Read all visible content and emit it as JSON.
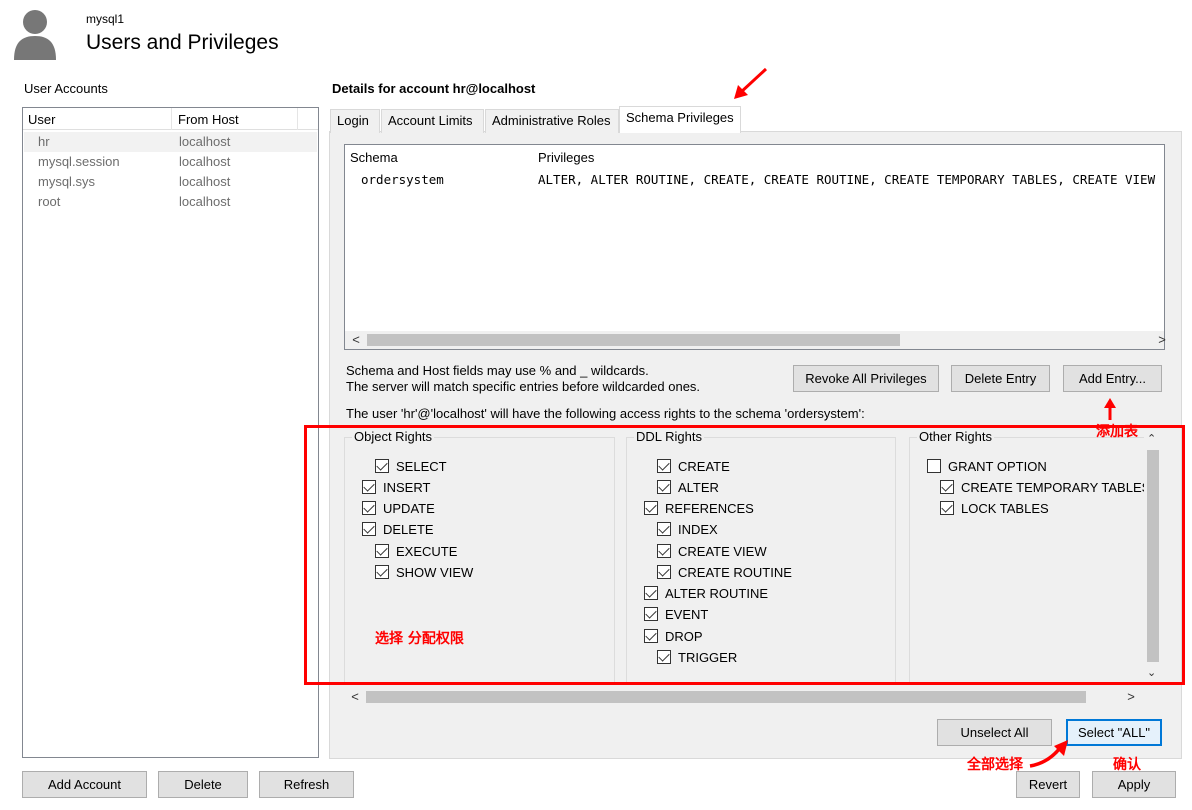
{
  "header": {
    "connection_name": "mysql1",
    "title": "Users and Privileges"
  },
  "accounts": {
    "label": "User Accounts",
    "columns": [
      "User",
      "From Host"
    ],
    "rows": [
      {
        "user": "hr",
        "host": "localhost"
      },
      {
        "user": "mysql.session",
        "host": "localhost"
      },
      {
        "user": "mysql.sys",
        "host": "localhost"
      },
      {
        "user": "root",
        "host": "localhost"
      }
    ],
    "buttons": {
      "add": "Add Account",
      "delete": "Delete",
      "refresh": "Refresh"
    }
  },
  "details": {
    "title": "Details for account hr@localhost",
    "tabs": [
      "Login",
      "Account Limits",
      "Administrative Roles",
      "Schema Privileges"
    ],
    "active_tab": "Schema Privileges",
    "grid": {
      "columns": [
        "Schema",
        "Privileges"
      ],
      "rows": [
        {
          "schema": "ordersystem",
          "privileges": "ALTER, ALTER ROUTINE, CREATE, CREATE ROUTINE, CREATE TEMPORARY TABLES, CREATE VIEW"
        }
      ]
    },
    "hint_line1": "Schema and Host fields may use % and _ wildcards.",
    "hint_line2": "The server will match specific entries before wildcarded ones.",
    "buttons": {
      "revoke_all": "Revoke All Privileges",
      "delete_entry": "Delete Entry",
      "add_entry": "Add Entry..."
    },
    "access_text": "The user 'hr'@'localhost' will have the following access rights to the schema 'ordersystem':",
    "object_rights": {
      "label": "Object Rights",
      "items": [
        {
          "label": "SELECT",
          "checked": true
        },
        {
          "label": "INSERT",
          "checked": true
        },
        {
          "label": "UPDATE",
          "checked": true
        },
        {
          "label": "DELETE",
          "checked": true
        },
        {
          "label": "EXECUTE",
          "checked": true
        },
        {
          "label": "SHOW VIEW",
          "checked": true
        }
      ]
    },
    "ddl_rights": {
      "label": "DDL Rights",
      "items": [
        {
          "label": "CREATE",
          "checked": true
        },
        {
          "label": "ALTER",
          "checked": true
        },
        {
          "label": "REFERENCES",
          "checked": true
        },
        {
          "label": "INDEX",
          "checked": true
        },
        {
          "label": "CREATE VIEW",
          "checked": true
        },
        {
          "label": "CREATE ROUTINE",
          "checked": true
        },
        {
          "label": "ALTER ROUTINE",
          "checked": true
        },
        {
          "label": "EVENT",
          "checked": true
        },
        {
          "label": "DROP",
          "checked": true
        },
        {
          "label": "TRIGGER",
          "checked": true
        }
      ]
    },
    "other_rights": {
      "label": "Other Rights",
      "items": [
        {
          "label": "GRANT OPTION",
          "checked": false
        },
        {
          "label": "CREATE TEMPORARY TABLES",
          "checked": true
        },
        {
          "label": "LOCK TABLES",
          "checked": true
        }
      ]
    },
    "unselect_all": "Unselect All",
    "select_all": "Select \"ALL\""
  },
  "footer": {
    "revert": "Revert",
    "apply": "Apply"
  },
  "annotations": {
    "add_table": "添加表",
    "select_assign": "选择  分配权限",
    "select_all": "全部选择",
    "confirm": "确认",
    "color": "#ff0000"
  }
}
